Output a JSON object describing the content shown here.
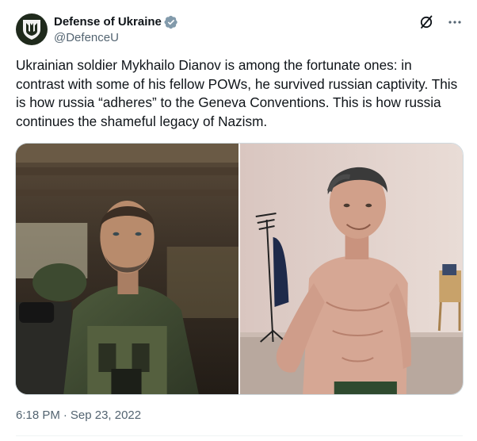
{
  "author": {
    "display_name": "Defense of Ukraine",
    "handle": "@DefenceU",
    "verified": true,
    "avatar_icon": "ukraine-mod-emblem-icon"
  },
  "tweet": {
    "text": "Ukrainian soldier Mykhailo Dianov is among the fortunate ones: in contrast with some of his fellow POWs, he survived russian captivity. This is how russia “adheres” to the Geneva Conventions. This is how russia continues the shameful legacy of Nazism.",
    "time": "6:18 PM",
    "separator": "·",
    "date": "Sep 23, 2022"
  },
  "actions": {
    "grok_icon": "grok-icon",
    "more_icon": "more-options-icon"
  },
  "colors": {
    "text_primary": "#0f1419",
    "text_secondary": "#536471",
    "verified_blue": "#1d9bf0",
    "border": "#cfd9de"
  }
}
